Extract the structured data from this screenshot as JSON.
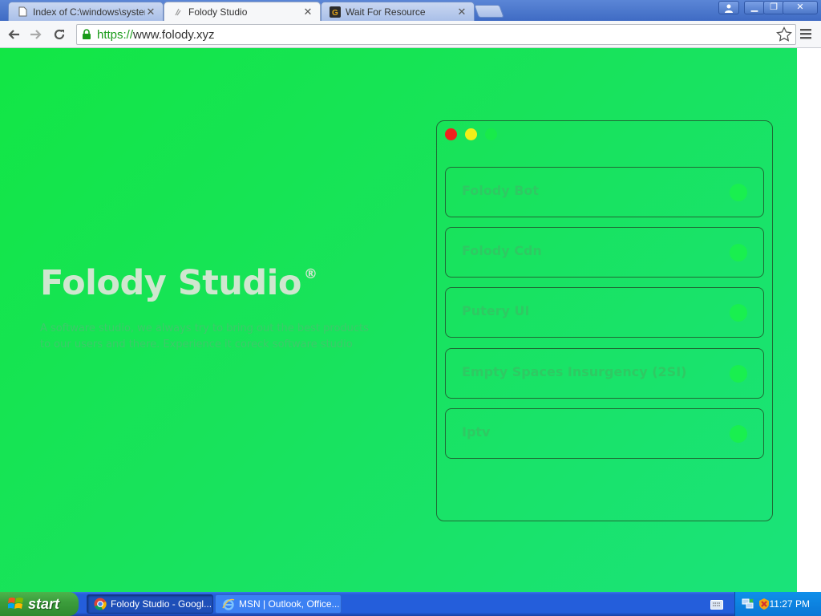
{
  "browser": {
    "tabs": [
      {
        "title": "Index of C:\\windows\\system",
        "icon": "file-icon",
        "active": false
      },
      {
        "title": "Folody Studio",
        "icon": "page-icon",
        "active": true
      },
      {
        "title": "Wait For Resource",
        "icon": "g-logo-icon",
        "active": false
      }
    ],
    "url_scheme": "https://",
    "url_host": "www.folody.xyz"
  },
  "page": {
    "brand": "Folody Studio",
    "brand_mark": "®",
    "description": "A software studio, we always try to bring out the best products to our users and there. Experience it coreck software studio",
    "colors": {
      "background_start": "#12e645",
      "background_end": "#1ae37a",
      "title": "#cfe6cf",
      "panel_border": "#1f6b36",
      "dot_red": "#f0211e",
      "dot_yellow": "#f2ee19",
      "dot_green": "#18ea4a"
    },
    "panel": {
      "items": [
        {
          "label": "Folody Bot"
        },
        {
          "label": "Folody Cdn"
        },
        {
          "label": "Putery UI"
        },
        {
          "label": "Empty Spaces Insurgency (2SI)"
        },
        {
          "label": "Iptv"
        }
      ]
    }
  },
  "taskbar": {
    "start_label": "start",
    "tasks": [
      {
        "label": "Folody Studio - Googl...",
        "icon": "chrome-icon",
        "active": true
      },
      {
        "label": "MSN | Outlook, Office...",
        "icon": "ie-icon",
        "active": false
      }
    ],
    "clock": "11:27 PM"
  }
}
